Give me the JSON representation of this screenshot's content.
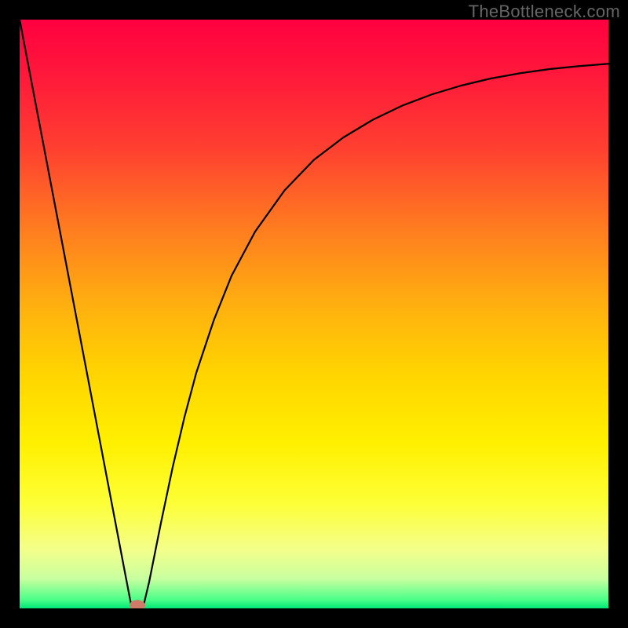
{
  "watermark": "TheBottleneck.com",
  "chart_data": {
    "type": "line",
    "title": "",
    "xlabel": "",
    "ylabel": "",
    "xlim": [
      0,
      100
    ],
    "ylim": [
      0,
      100
    ],
    "background": {
      "type": "vertical-gradient",
      "stops": [
        {
          "offset": 0.0,
          "color": "#ff0040"
        },
        {
          "offset": 0.1,
          "color": "#ff1a3a"
        },
        {
          "offset": 0.22,
          "color": "#ff4030"
        },
        {
          "offset": 0.35,
          "color": "#ff7a20"
        },
        {
          "offset": 0.48,
          "color": "#ffae10"
        },
        {
          "offset": 0.6,
          "color": "#ffd400"
        },
        {
          "offset": 0.72,
          "color": "#fff000"
        },
        {
          "offset": 0.82,
          "color": "#fdff35"
        },
        {
          "offset": 0.9,
          "color": "#f4ff8a"
        },
        {
          "offset": 0.95,
          "color": "#c8ffa0"
        },
        {
          "offset": 0.985,
          "color": "#4cff88"
        },
        {
          "offset": 1.0,
          "color": "#00e676"
        }
      ]
    },
    "series": [
      {
        "name": "bottleneck-curve",
        "color": "#000000",
        "width": 2.2,
        "x": [
          0,
          2,
          4,
          6,
          8,
          10,
          12,
          14,
          16,
          18,
          19,
          20,
          21,
          22,
          24,
          26,
          28,
          30,
          33,
          36,
          40,
          45,
          50,
          55,
          60,
          65,
          70,
          75,
          80,
          85,
          90,
          95,
          100
        ],
        "y": [
          100,
          89.5,
          79,
          68.5,
          58,
          47.5,
          37,
          26.5,
          16,
          5.5,
          0.3,
          0.0,
          0.3,
          4.5,
          14.5,
          24,
          32.5,
          40,
          49,
          56.5,
          64,
          71,
          76.2,
          80,
          83,
          85.4,
          87.3,
          88.8,
          90,
          90.9,
          91.6,
          92.1,
          92.5
        ]
      }
    ],
    "marker": {
      "name": "minimum-point",
      "x": 20,
      "y": 0.5,
      "color": "#d07a6a",
      "rx": 10,
      "ry": 7
    }
  }
}
